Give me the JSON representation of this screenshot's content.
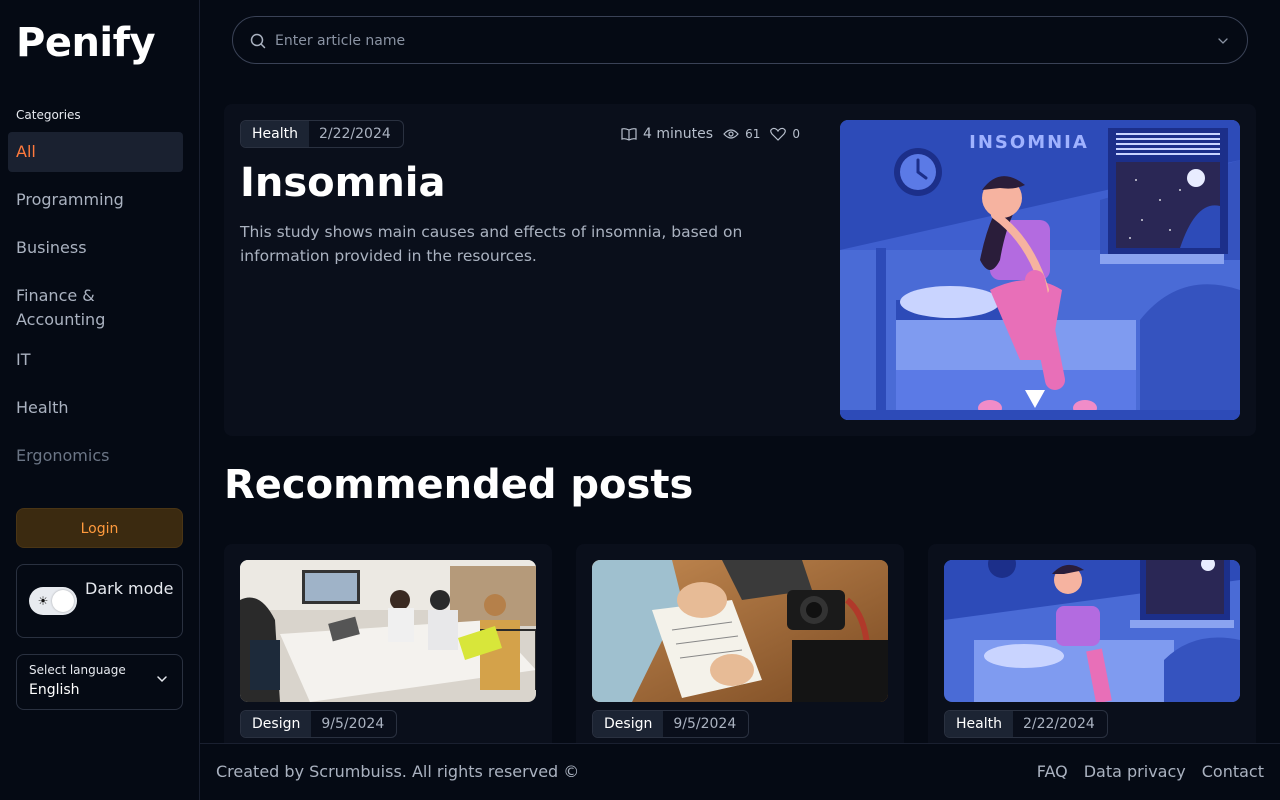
{
  "brand": "Penify",
  "sidebar": {
    "categories_heading": "Categories",
    "items": [
      {
        "label": "All"
      },
      {
        "label": "Programming"
      },
      {
        "label": "Business"
      },
      {
        "label": "Finance & Accounting"
      },
      {
        "label": "IT"
      },
      {
        "label": "Health"
      },
      {
        "label": "Ergonomics"
      }
    ],
    "login_label": "Login",
    "dark_mode_label": "Dark mode",
    "language_caption": "Select language",
    "language_value": "English"
  },
  "search": {
    "placeholder": "Enter article name"
  },
  "featured": {
    "tag": "Health",
    "date": "2/22/2024",
    "read_time": "4 minutes",
    "views": "61",
    "likes": "0",
    "title": "Insomnia",
    "description": "This study shows main causes and effects of insomnia, based on information provided in the resources.",
    "image_title": "INSOMNIA"
  },
  "recommended": {
    "title": "Recommended posts",
    "posts": [
      {
        "tag": "Design",
        "date": "9/5/2024"
      },
      {
        "tag": "Design",
        "date": "9/5/2024"
      },
      {
        "tag": "Health",
        "date": "2/22/2024"
      }
    ]
  },
  "footer": {
    "copyright": "Created by Scrumbuiss. All rights reserved ©",
    "links": [
      "FAQ",
      "Data privacy",
      "Contact"
    ]
  },
  "colors": {
    "accent": "#ff7a3d",
    "background": "#050a14",
    "card": "#0a0f1b",
    "illustration_blue": "#4a6bd6"
  }
}
